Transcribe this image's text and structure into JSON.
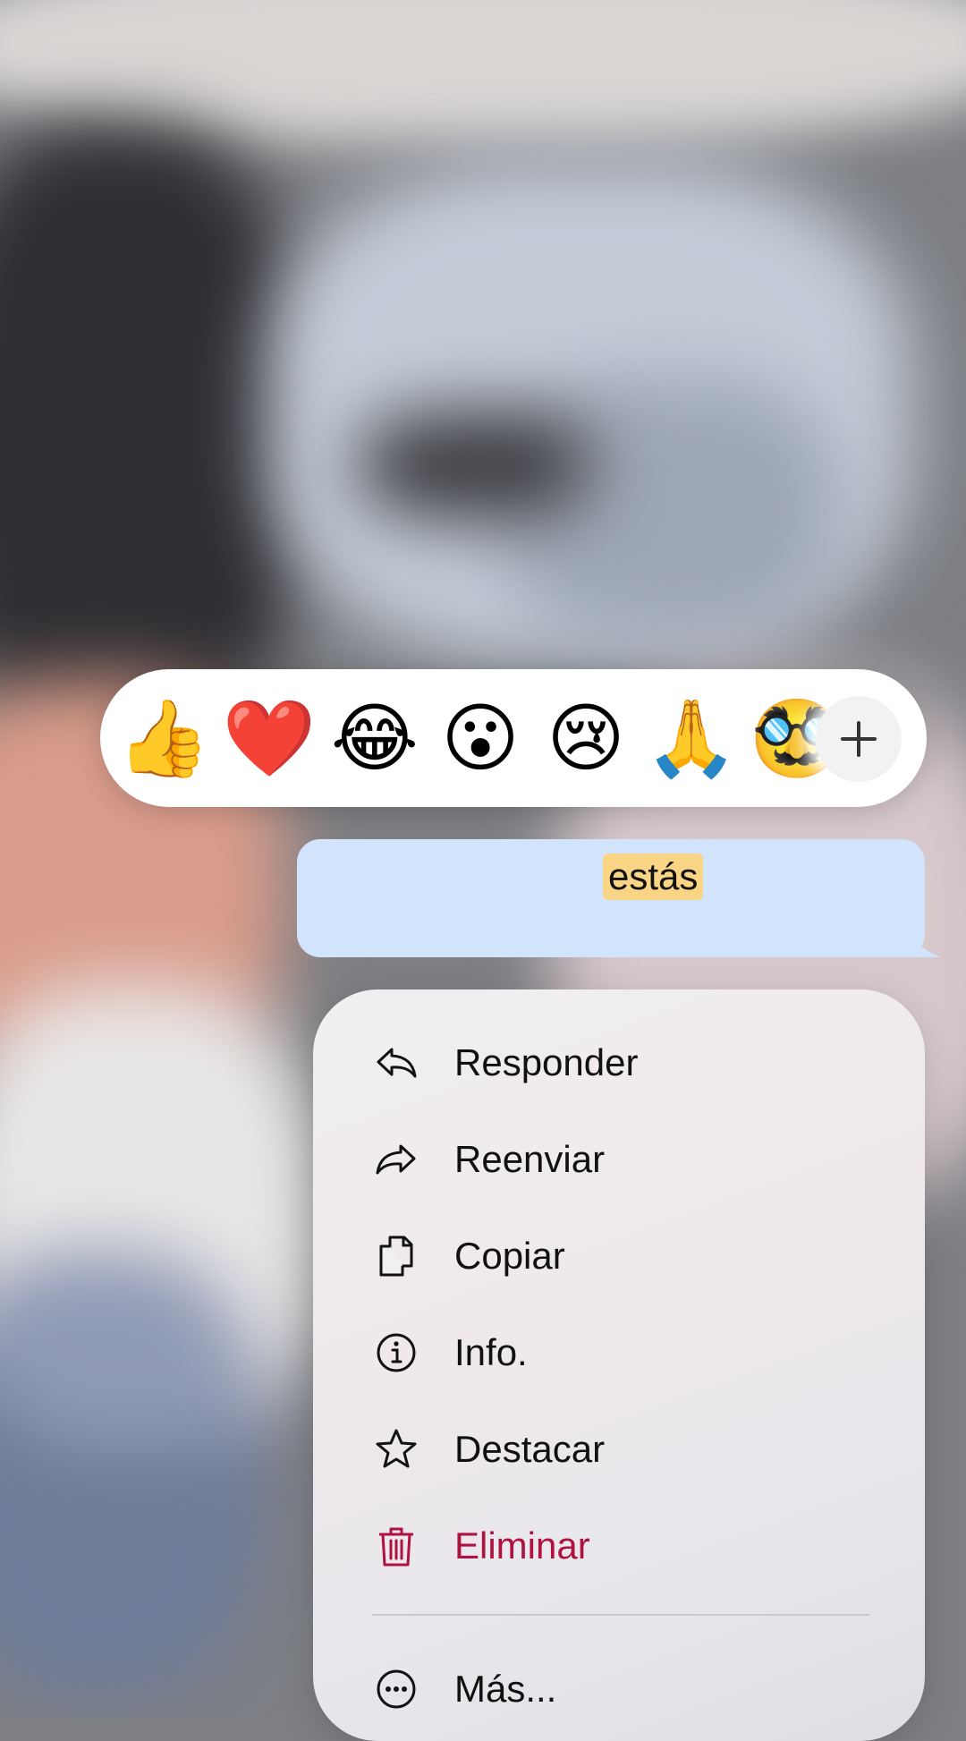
{
  "reactions": {
    "emojis": [
      "👍",
      "❤️",
      "😂",
      "😮",
      "😢",
      "🙏",
      "🥸"
    ],
    "more_icon": "plus-icon"
  },
  "message": {
    "text": "estás",
    "bubble_color": "#d2e4fb",
    "highlight_color": "#fad585"
  },
  "menu": {
    "items": [
      {
        "label": "Responder",
        "icon": "reply-icon"
      },
      {
        "label": "Reenviar",
        "icon": "forward-icon"
      },
      {
        "label": "Copiar",
        "icon": "copy-icon"
      },
      {
        "label": "Info.",
        "icon": "info-icon"
      },
      {
        "label": "Destacar",
        "icon": "star-icon"
      },
      {
        "label": "Eliminar",
        "icon": "trash-icon",
        "color": "#b0123f"
      },
      {
        "label": "Más...",
        "icon": "more-icon"
      }
    ]
  }
}
